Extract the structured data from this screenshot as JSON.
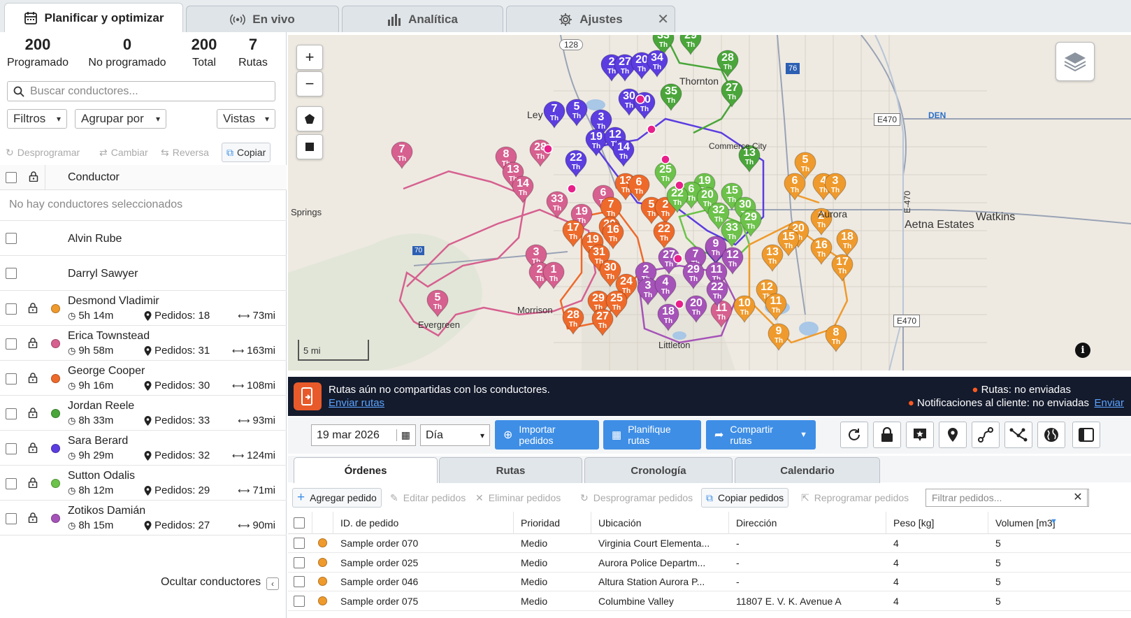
{
  "tabs": [
    {
      "label": "Planificar y optimizar",
      "icon": "calendar-icon"
    },
    {
      "label": "En vivo",
      "icon": "broadcast-icon"
    },
    {
      "label": "Analítica",
      "icon": "bar-chart-icon"
    },
    {
      "label": "Ajustes",
      "icon": "gear-icon"
    }
  ],
  "stats": [
    {
      "value": "200",
      "label": "Programado"
    },
    {
      "value": "0",
      "label": "No programado"
    },
    {
      "value": "200",
      "label": "Total"
    },
    {
      "value": "7",
      "label": "Rutas"
    }
  ],
  "search": {
    "placeholder": "Buscar conductores..."
  },
  "dropdowns": {
    "filters": "Filtros",
    "group": "Agrupar por",
    "views": "Vistas"
  },
  "actions": {
    "unschedule": "Desprogramar",
    "change": "Cambiar",
    "reverse": "Reversa",
    "copy": "Copiar"
  },
  "driver_header": "Conductor",
  "no_selection": "No hay conductores seleccionados",
  "drivers_unassigned": [
    "Alvin Rube",
    "Darryl Sawyer"
  ],
  "drivers": [
    {
      "name": "Desmond Vladimir",
      "time": "5h 14m",
      "orders": "Pedidos: 18",
      "dist": "73mi",
      "color": "#ef9a2c"
    },
    {
      "name": "Erica Townstead",
      "time": "9h 58m",
      "orders": "Pedidos: 31",
      "dist": "163mi",
      "color": "#d6608f"
    },
    {
      "name": "George Cooper",
      "time": "9h 16m",
      "orders": "Pedidos: 30",
      "dist": "108mi",
      "color": "#ee6a2a"
    },
    {
      "name": "Jordan Reele",
      "time": "8h 33m",
      "orders": "Pedidos: 33",
      "dist": "93mi",
      "color": "#4aa63a"
    },
    {
      "name": "Sara Berard",
      "time": "9h 29m",
      "orders": "Pedidos: 32",
      "dist": "124mi",
      "color": "#5b3de0"
    },
    {
      "name": "Sutton Odalis",
      "time": "8h 12m",
      "orders": "Pedidos: 29",
      "dist": "71mi",
      "color": "#6cc24a"
    },
    {
      "name": "Zotikos Damián",
      "time": "8h 15m",
      "orders": "Pedidos: 27",
      "dist": "90mi",
      "color": "#a553b8"
    }
  ],
  "hide_drivers": "Ocultar conductores",
  "map": {
    "scale": "5 mi",
    "places": [
      "Thornton",
      "Commerce City",
      "Springs",
      "Aurora",
      "Watkins",
      "Aetna Estates",
      "Morrison",
      "Evergreen",
      "Littleton",
      "Ley",
      "DEN"
    ],
    "roads": [
      "128",
      "76",
      "E470",
      "E470",
      "E-470",
      "70"
    ],
    "pin_suffix": "Th",
    "pins": [
      {
        "n": "33",
        "c": "#4aa63a"
      },
      {
        "n": "29",
        "c": "#4aa63a"
      },
      {
        "n": "28",
        "c": "#4aa63a"
      },
      {
        "n": "27",
        "c": "#4aa63a"
      },
      {
        "n": "35",
        "c": "#4aa63a"
      },
      {
        "n": "13",
        "c": "#4aa63a"
      },
      {
        "n": "2",
        "c": "#5b3de0"
      },
      {
        "n": "27",
        "c": "#5b3de0"
      },
      {
        "n": "20",
        "c": "#5b3de0"
      },
      {
        "n": "34",
        "c": "#5b3de0"
      },
      {
        "n": "30",
        "c": "#5b3de0"
      },
      {
        "n": "10",
        "c": "#5b3de0"
      },
      {
        "n": "7",
        "c": "#5b3de0"
      },
      {
        "n": "5",
        "c": "#5b3de0"
      },
      {
        "n": "3",
        "c": "#5b3de0"
      },
      {
        "n": "19",
        "c": "#5b3de0"
      },
      {
        "n": "12",
        "c": "#5b3de0"
      },
      {
        "n": "14",
        "c": "#5b3de0"
      },
      {
        "n": "22",
        "c": "#5b3de0"
      },
      {
        "n": "12",
        "c": "#5b3de0"
      },
      {
        "n": "7",
        "c": "#d6608f"
      },
      {
        "n": "28",
        "c": "#d6608f"
      },
      {
        "n": "8",
        "c": "#d6608f"
      },
      {
        "n": "13",
        "c": "#d6608f"
      },
      {
        "n": "14",
        "c": "#d6608f"
      },
      {
        "n": "33",
        "c": "#d6608f"
      },
      {
        "n": "19",
        "c": "#d6608f"
      },
      {
        "n": "6",
        "c": "#d6608f"
      },
      {
        "n": "3",
        "c": "#d6608f"
      },
      {
        "n": "2",
        "c": "#d6608f"
      },
      {
        "n": "1",
        "c": "#d6608f"
      },
      {
        "n": "5",
        "c": "#d6608f"
      },
      {
        "n": "11",
        "c": "#d6608f"
      },
      {
        "n": "13",
        "c": "#ee6a2a"
      },
      {
        "n": "6",
        "c": "#ee6a2a"
      },
      {
        "n": "7",
        "c": "#ee6a2a"
      },
      {
        "n": "20",
        "c": "#ee6a2a"
      },
      {
        "n": "16",
        "c": "#ee6a2a"
      },
      {
        "n": "17",
        "c": "#ee6a2a"
      },
      {
        "n": "19",
        "c": "#ee6a2a"
      },
      {
        "n": "31",
        "c": "#ee6a2a"
      },
      {
        "n": "30",
        "c": "#ee6a2a"
      },
      {
        "n": "24",
        "c": "#ee6a2a"
      },
      {
        "n": "29",
        "c": "#ee6a2a"
      },
      {
        "n": "25",
        "c": "#ee6a2a"
      },
      {
        "n": "28",
        "c": "#ee6a2a"
      },
      {
        "n": "27",
        "c": "#ee6a2a"
      },
      {
        "n": "5",
        "c": "#ee6a2a"
      },
      {
        "n": "2",
        "c": "#ee6a2a"
      },
      {
        "n": "22",
        "c": "#ee6a2a"
      },
      {
        "n": "25",
        "c": "#6cc24a"
      },
      {
        "n": "19",
        "c": "#6cc24a"
      },
      {
        "n": "6",
        "c": "#6cc24a"
      },
      {
        "n": "20",
        "c": "#6cc24a"
      },
      {
        "n": "15",
        "c": "#6cc24a"
      },
      {
        "n": "22",
        "c": "#6cc24a"
      },
      {
        "n": "32",
        "c": "#6cc24a"
      },
      {
        "n": "30",
        "c": "#6cc24a"
      },
      {
        "n": "29",
        "c": "#6cc24a"
      },
      {
        "n": "33",
        "c": "#6cc24a"
      },
      {
        "n": "9",
        "c": "#a553b8"
      },
      {
        "n": "7",
        "c": "#a553b8"
      },
      {
        "n": "12",
        "c": "#a553b8"
      },
      {
        "n": "27",
        "c": "#a553b8"
      },
      {
        "n": "2",
        "c": "#a553b8"
      },
      {
        "n": "29",
        "c": "#a553b8"
      },
      {
        "n": "11",
        "c": "#a553b8"
      },
      {
        "n": "3",
        "c": "#a553b8"
      },
      {
        "n": "4",
        "c": "#a553b8"
      },
      {
        "n": "22",
        "c": "#a553b8"
      },
      {
        "n": "18",
        "c": "#a553b8"
      },
      {
        "n": "20",
        "c": "#a553b8"
      },
      {
        "n": "5",
        "c": "#ef9a2c"
      },
      {
        "n": "6",
        "c": "#ef9a2c"
      },
      {
        "n": "4",
        "c": "#ef9a2c"
      },
      {
        "n": "3",
        "c": "#ef9a2c"
      },
      {
        "n": "2",
        "c": "#ef9a2c"
      },
      {
        "n": "20",
        "c": "#ef9a2c"
      },
      {
        "n": "15",
        "c": "#ef9a2c"
      },
      {
        "n": "16",
        "c": "#ef9a2c"
      },
      {
        "n": "18",
        "c": "#ef9a2c"
      },
      {
        "n": "13",
        "c": "#ef9a2c"
      },
      {
        "n": "17",
        "c": "#ef9a2c"
      },
      {
        "n": "12",
        "c": "#ef9a2c"
      },
      {
        "n": "11",
        "c": "#ef9a2c"
      },
      {
        "n": "10",
        "c": "#ef9a2c"
      },
      {
        "n": "9",
        "c": "#ef9a2c"
      },
      {
        "n": "8",
        "c": "#ef9a2c"
      }
    ]
  },
  "banner": {
    "message": "Rutas aún no compartidas con los conductores.",
    "link": "Enviar rutas",
    "status1": "Rutas: no enviadas",
    "status2": "Notificaciones al cliente: no enviadas",
    "status2_link": "Enviar"
  },
  "toolbar": {
    "date": "19 mar 2026",
    "period": "Día",
    "import": "Importar pedidos",
    "plan": "Planifique rutas",
    "share": "Compartir rutas"
  },
  "order_tabs": [
    "Órdenes",
    "Rutas",
    "Cronología",
    "Calendario"
  ],
  "order_actions": {
    "add": "Agregar pedido",
    "edit": "Editar pedidos",
    "delete": "Eliminar pedidos",
    "unschedule": "Desprogramar pedidos",
    "copy": "Copiar pedidos",
    "reschedule": "Reprogramar pedidos",
    "filter_placeholder": "Filtrar pedidos..."
  },
  "table": {
    "columns": [
      "ID. de pedido",
      "Prioridad",
      "Ubicación",
      "Dirección",
      "Peso [kg]",
      "Volumen [m3]"
    ],
    "rows": [
      {
        "id": "Sample order 070",
        "priority": "Medio",
        "location": "Virginia Court Elementa...",
        "address": "-",
        "weight": "4",
        "volume": "5",
        "color": "#ef9a2c"
      },
      {
        "id": "Sample order 025",
        "priority": "Medio",
        "location": "Aurora Police Departm...",
        "address": "-",
        "weight": "4",
        "volume": "5",
        "color": "#ef9a2c"
      },
      {
        "id": "Sample order 046",
        "priority": "Medio",
        "location": "Altura Station Aurora P...",
        "address": "-",
        "weight": "4",
        "volume": "5",
        "color": "#ef9a2c"
      },
      {
        "id": "Sample order 075",
        "priority": "Medio",
        "location": "Columbine Valley",
        "address": "11807 E. V. K. Avenue A",
        "weight": "4",
        "volume": "5",
        "color": "#ef9a2c"
      }
    ]
  }
}
